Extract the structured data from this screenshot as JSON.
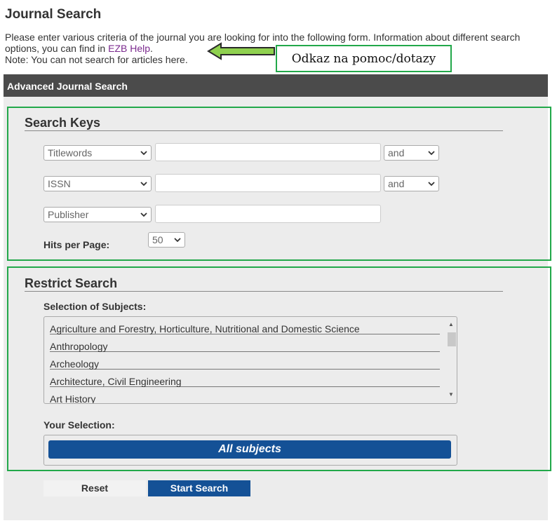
{
  "page": {
    "title": "Journal Search",
    "intro_part1": "Please enter various criteria of the journal you are looking for into the following form. Information about different search options, you can find in ",
    "help_link": "EZB Help",
    "intro_part2": ".",
    "note": "Note: You can not search for articles here."
  },
  "callout": {
    "text": "Odkaz na pomoc/dotazy",
    "color": "#22a84a"
  },
  "panel": {
    "header": "Advanced Journal Search"
  },
  "search_keys": {
    "title": "Search Keys",
    "rows": [
      {
        "field": "Titlewords",
        "value": "",
        "operator": "and"
      },
      {
        "field": "ISSN",
        "value": "",
        "operator": "and"
      },
      {
        "field": "Publisher",
        "value": ""
      }
    ],
    "hits_label": "Hits per Page:",
    "hits_value": "50"
  },
  "restrict": {
    "title": "Restrict Search",
    "subjects_label": "Selection of Subjects:",
    "subjects": [
      "Agriculture and Forestry, Horticulture, Nutritional and Domestic Science",
      "Anthropology",
      "Archeology",
      "Architecture, Civil Engineering",
      "Art History"
    ],
    "selection_label": "Your Selection:",
    "selection_value": "All subjects"
  },
  "buttons": {
    "reset": "Reset",
    "start": "Start Search"
  },
  "colors": {
    "accent": "#145196",
    "header_bg": "#4b4b4b",
    "highlight": "#22a84a",
    "link": "#7b2a8e"
  }
}
